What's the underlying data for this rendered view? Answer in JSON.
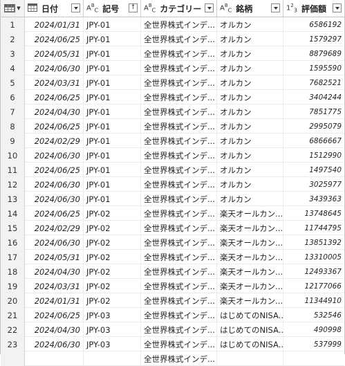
{
  "headers": {
    "corner_type": "table",
    "date": {
      "type": "calendar",
      "label": "日付"
    },
    "code": {
      "type": "ABC",
      "label": "記号"
    },
    "category": {
      "type": "ABC",
      "label": "カテゴリー"
    },
    "name": {
      "type": "ABC",
      "label": "銘柄"
    },
    "value": {
      "type": "123",
      "label": "評価額"
    }
  },
  "rows": [
    {
      "idx": "1",
      "date": "2024/01/31",
      "code": "JPY-01",
      "category": "全世界株式インデ...",
      "name": "オルカン",
      "value": "6586192"
    },
    {
      "idx": "2",
      "date": "2024/06/25",
      "code": "JPY-01",
      "category": "全世界株式インデ...",
      "name": "オルカン",
      "value": "1579297"
    },
    {
      "idx": "3",
      "date": "2024/05/31",
      "code": "JPY-01",
      "category": "全世界株式インデ...",
      "name": "オルカン",
      "value": "8879689"
    },
    {
      "idx": "4",
      "date": "2024/06/30",
      "code": "JPY-01",
      "category": "全世界株式インデ...",
      "name": "オルカン",
      "value": "1595590"
    },
    {
      "idx": "5",
      "date": "2024/03/31",
      "code": "JPY-01",
      "category": "全世界株式インデ...",
      "name": "オルカン",
      "value": "7682521"
    },
    {
      "idx": "6",
      "date": "2024/06/25",
      "code": "JPY-01",
      "category": "全世界株式インデ...",
      "name": "オルカン",
      "value": "3404244"
    },
    {
      "idx": "7",
      "date": "2024/04/30",
      "code": "JPY-01",
      "category": "全世界株式インデ...",
      "name": "オルカン",
      "value": "7851775"
    },
    {
      "idx": "8",
      "date": "2024/06/25",
      "code": "JPY-01",
      "category": "全世界株式インデ...",
      "name": "オルカン",
      "value": "2995079"
    },
    {
      "idx": "9",
      "date": "2024/02/29",
      "code": "JPY-01",
      "category": "全世界株式インデ...",
      "name": "オルカン",
      "value": "6866667"
    },
    {
      "idx": "10",
      "date": "2024/06/30",
      "code": "JPY-01",
      "category": "全世界株式インデ...",
      "name": "オルカン",
      "value": "1512990"
    },
    {
      "idx": "11",
      "date": "2024/06/25",
      "code": "JPY-01",
      "category": "全世界株式インデ...",
      "name": "オルカン",
      "value": "1497540"
    },
    {
      "idx": "12",
      "date": "2024/06/30",
      "code": "JPY-01",
      "category": "全世界株式インデ...",
      "name": "オルカン",
      "value": "3025977"
    },
    {
      "idx": "13",
      "date": "2024/06/30",
      "code": "JPY-01",
      "category": "全世界株式インデ...",
      "name": "オルカン",
      "value": "3439363"
    },
    {
      "idx": "14",
      "date": "2024/06/25",
      "code": "JPY-02",
      "category": "全世界株式インデ...",
      "name": "楽天オールカン...",
      "value": "13748645"
    },
    {
      "idx": "15",
      "date": "2024/02/29",
      "code": "JPY-02",
      "category": "全世界株式インデ...",
      "name": "楽天オールカン...",
      "value": "11744795"
    },
    {
      "idx": "16",
      "date": "2024/06/30",
      "code": "JPY-02",
      "category": "全世界株式インデ...",
      "name": "楽天オールカン...",
      "value": "13851392"
    },
    {
      "idx": "17",
      "date": "2024/05/31",
      "code": "JPY-02",
      "category": "全世界株式インデ...",
      "name": "楽天オールカン...",
      "value": "13310005"
    },
    {
      "idx": "18",
      "date": "2024/04/30",
      "code": "JPY-02",
      "category": "全世界株式インデ...",
      "name": "楽天オールカン...",
      "value": "12493367"
    },
    {
      "idx": "19",
      "date": "2024/03/31",
      "code": "JPY-02",
      "category": "全世界株式インデ...",
      "name": "楽天オールカン...",
      "value": "12177066"
    },
    {
      "idx": "20",
      "date": "2024/01/31",
      "code": "JPY-02",
      "category": "全世界株式インデ...",
      "name": "楽天オールカン...",
      "value": "11344910"
    },
    {
      "idx": "21",
      "date": "2024/06/25",
      "code": "JPY-03",
      "category": "全世界株式インデ...",
      "name": "はじめてのNISA...",
      "value": "532546"
    },
    {
      "idx": "22",
      "date": "2024/04/30",
      "code": "JPY-03",
      "category": "全世界株式インデ...",
      "name": "はじめてのNISA...",
      "value": "490998"
    },
    {
      "idx": "23",
      "date": "2024/06/30",
      "code": "JPY-03",
      "category": "全世界株式インデ...",
      "name": "はじめてのNISA...",
      "value": "537999"
    },
    {
      "idx": "",
      "date": "",
      "code": "",
      "category": "全世界株式インデ...",
      "name": "",
      "value": ""
    }
  ]
}
